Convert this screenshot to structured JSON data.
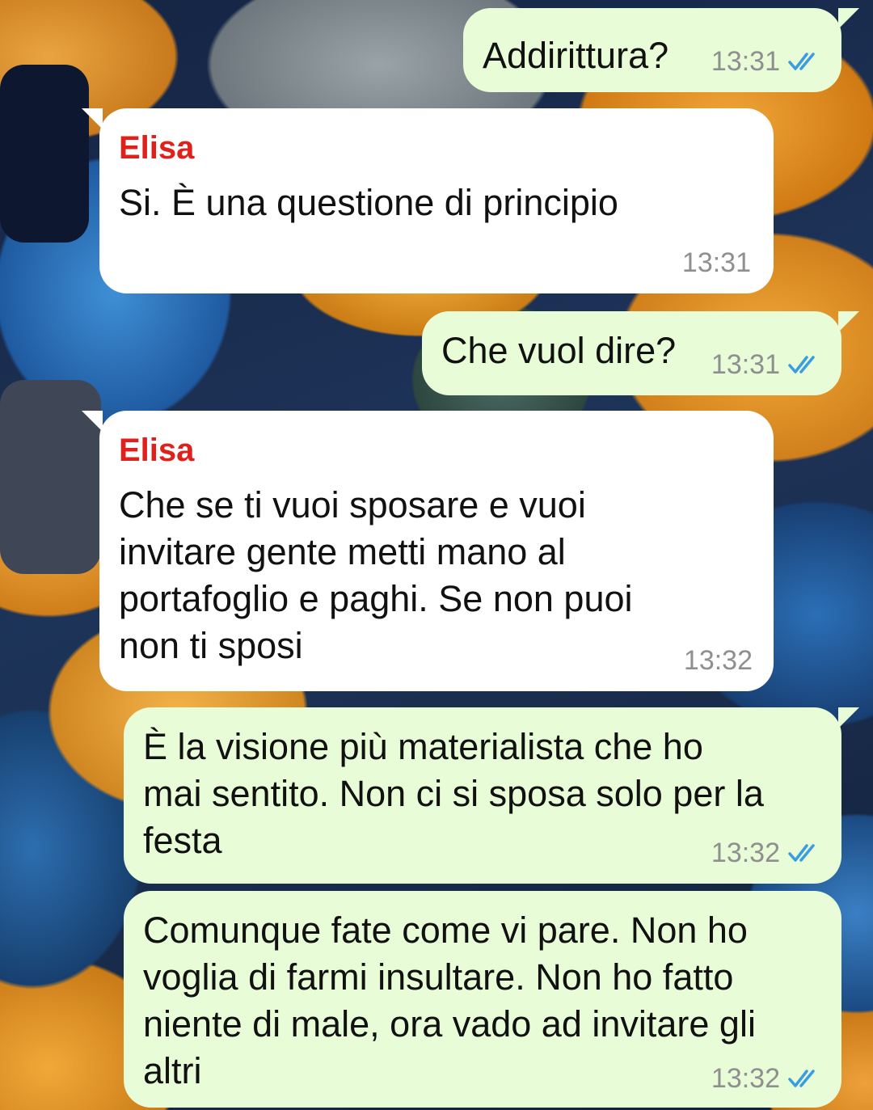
{
  "conversation": {
    "messages": [
      {
        "direction": "outgoing",
        "text": "Addirittura?",
        "time": "13:31",
        "status": "read"
      },
      {
        "direction": "incoming",
        "sender": "Elisa",
        "text": "Si. È una questione di principio",
        "time": "13:31"
      },
      {
        "direction": "outgoing",
        "text": "Che vuol dire?",
        "time": "13:31",
        "status": "read"
      },
      {
        "direction": "incoming",
        "sender": "Elisa",
        "text": "Che se ti vuoi sposare e vuoi\ninvitare gente metti mano al\nportafoglio e paghi. Se non puoi\nnon ti sposi",
        "time": "13:32"
      },
      {
        "direction": "outgoing",
        "text": "È la visione più materialista che ho\nmai sentito. Non ci si sposa solo per la\nfesta",
        "time": "13:32",
        "status": "read"
      },
      {
        "direction": "outgoing",
        "text": "Comunque fate come vi pare. Non ho\nvoglia di farmi insultare. Non ho fatto\nniente di male, ora vado ad invitare gli\naltri",
        "time": "13:32",
        "status": "read"
      }
    ]
  },
  "colors": {
    "sender_name": "#e0201b",
    "outgoing_bubble": "#e7fcd7",
    "incoming_bubble": "#ffffff",
    "read_ticks": "#3a9de0",
    "timestamp": "#8f8f8f"
  },
  "icons": {
    "read_status": "double-check-icon"
  }
}
